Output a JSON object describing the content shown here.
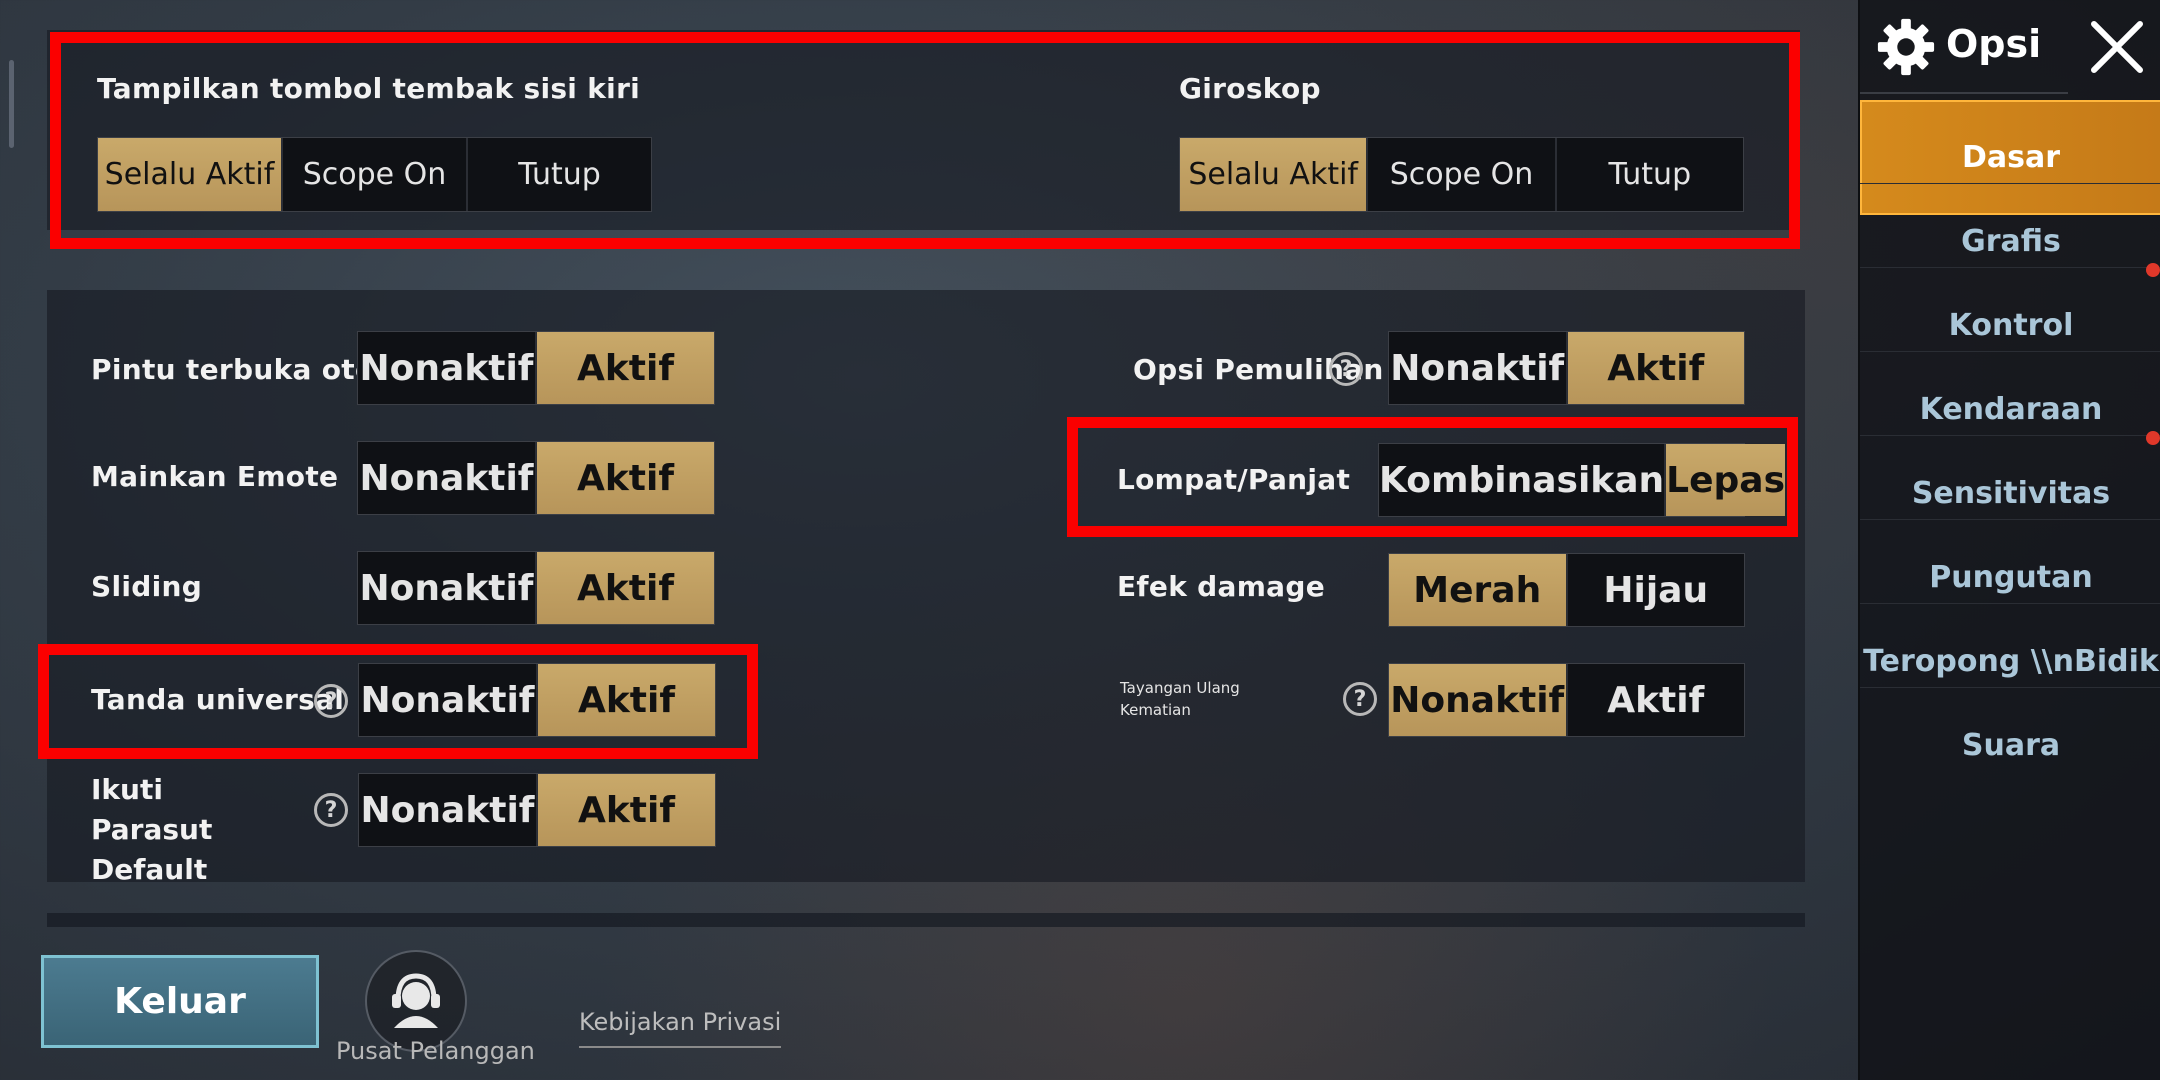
{
  "top_panel": {
    "left_fire": {
      "label": "Tampilkan tombol tembak sisi kiri",
      "options": [
        "Selalu Aktif",
        "Scope On",
        "Tutup"
      ],
      "selected": "Selalu Aktif"
    },
    "gyroscope": {
      "label": "Giroskop",
      "options": [
        "Selalu Aktif",
        "Scope On",
        "Tutup"
      ],
      "selected": "Selalu Aktif"
    }
  },
  "settings": {
    "auto_open_door": {
      "label": "Pintu terbuka otomatis",
      "options": [
        "Nonaktif",
        "Aktif"
      ],
      "selected": "Aktif"
    },
    "play_emote": {
      "label": "Mainkan Emote",
      "options": [
        "Nonaktif",
        "Aktif"
      ],
      "selected": "Aktif"
    },
    "sliding": {
      "label": "Sliding",
      "options": [
        "Nonaktif",
        "Aktif"
      ],
      "selected": "Aktif"
    },
    "universal_mark": {
      "label": "Tanda universal",
      "help": "?",
      "options": [
        "Nonaktif",
        "Aktif"
      ],
      "selected": "Aktif"
    },
    "follow_parachute": {
      "label": "Ikuti Parasut Default",
      "help": "?",
      "options": [
        "Nonaktif",
        "Aktif"
      ],
      "selected": "Aktif"
    },
    "recovery_option": {
      "label": "Opsi Pemulihan",
      "help": "?",
      "options": [
        "Nonaktif",
        "Aktif"
      ],
      "selected": "Aktif"
    },
    "jump_climb": {
      "label": "Lompat/Panjat",
      "options": [
        "Kombinasikan",
        "Lepas"
      ],
      "selected": "Lepas"
    },
    "damage_effect": {
      "label": "Efek damage",
      "options": [
        "Merah",
        "Hijau"
      ],
      "selected": "Merah"
    },
    "death_replay": {
      "label": "Tayangan Ulang Kematian",
      "help": "?",
      "options": [
        "Nonaktif",
        "Aktif"
      ],
      "selected": "Nonaktif"
    }
  },
  "sidebar": {
    "title": "Opsi",
    "items": [
      {
        "label": "Dasar",
        "active": true
      },
      {
        "label": "Grafis"
      },
      {
        "label": "Kontrol",
        "notification": true
      },
      {
        "label": "Kendaraan"
      },
      {
        "label": "Sensitivitas",
        "notification": true
      },
      {
        "label": "Pungutan"
      },
      {
        "label": "Teropong \\\\nBidik"
      },
      {
        "label": "Suara"
      }
    ]
  },
  "bottom": {
    "exit_label": "Keluar",
    "customer_service_label": "Pusat Pelanggan",
    "privacy_label": "Kebijakan Privasi"
  },
  "colors": {
    "highlight": "#fb0000",
    "selected_gold": "#c0a060",
    "sidebar_active": "#d58a1c",
    "notification": "#e0382a"
  }
}
